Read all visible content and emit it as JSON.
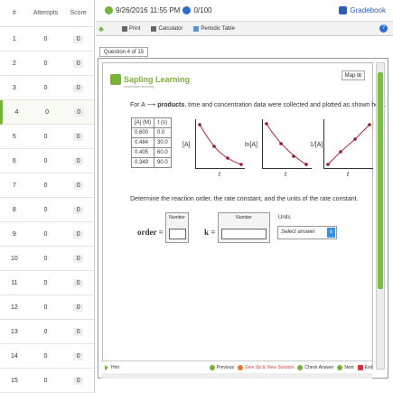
{
  "attempts_table": {
    "headers": [
      "#",
      "Attempts",
      "Score"
    ],
    "rows": [
      {
        "n": "1",
        "attempts": "0",
        "score": "0"
      },
      {
        "n": "2",
        "attempts": "0",
        "score": "0"
      },
      {
        "n": "3",
        "attempts": "0",
        "score": "0"
      },
      {
        "n": "4",
        "attempts": "0",
        "score": "0"
      },
      {
        "n": "5",
        "attempts": "0",
        "score": "0"
      },
      {
        "n": "6",
        "attempts": "0",
        "score": "0"
      },
      {
        "n": "7",
        "attempts": "0",
        "score": "0"
      },
      {
        "n": "8",
        "attempts": "0",
        "score": "0"
      },
      {
        "n": "9",
        "attempts": "0",
        "score": "0"
      },
      {
        "n": "10",
        "attempts": "0",
        "score": "0"
      },
      {
        "n": "11",
        "attempts": "0",
        "score": "0"
      },
      {
        "n": "12",
        "attempts": "0",
        "score": "0"
      },
      {
        "n": "13",
        "attempts": "0",
        "score": "0"
      },
      {
        "n": "14",
        "attempts": "0",
        "score": "0"
      },
      {
        "n": "15",
        "attempts": "0",
        "score": "0"
      }
    ],
    "active_row": 4
  },
  "header": {
    "datetime": "9/26/2016 11:55 PM",
    "score": "0/100",
    "gradebook": "Gradebook"
  },
  "toolbar": {
    "print": "Print",
    "calculator": "Calculator",
    "periodic_table": "Periodic Table"
  },
  "question_tab": "Question 4 of 15",
  "brand": {
    "name": "Sapling Learning",
    "tagline": "macmillan learning"
  },
  "map_label": "Map",
  "question": {
    "intro_prefix": "For",
    "reaction": "A ⟶",
    "bold_word": "products",
    "intro_suffix": ",  time and concentration data were collected and plotted as shown here.",
    "table_headers": [
      "[A] (M)",
      "t (s)"
    ],
    "table_rows": [
      [
        "0.600",
        "0.0"
      ],
      [
        "0.484",
        "30.0"
      ],
      [
        "0.405",
        "60.0"
      ],
      [
        "0.349",
        "90.0"
      ]
    ],
    "graphs": [
      {
        "ylabel": "[A]",
        "xlabel": "t"
      },
      {
        "ylabel": "ln[A]",
        "xlabel": "t"
      },
      {
        "ylabel": "1/[A]",
        "xlabel": "t"
      }
    ],
    "prompt": "Determine the reaction order, the rate constant, and the units of the rate constant.",
    "order_label": "order =",
    "k_label": "k =",
    "number_caption": "Number",
    "units_caption": "Units",
    "units_placeholder": "Select answer"
  },
  "footer": {
    "hint": "Hint",
    "previous": "Previous",
    "give_up": "Give Up & View Solution",
    "check_answer": "Check Answer",
    "next": "Next",
    "exit": "Exit"
  },
  "colors": {
    "accent_green": "#79b23b",
    "link_blue": "#2a5fb4",
    "curve_red": "#b3263a"
  }
}
